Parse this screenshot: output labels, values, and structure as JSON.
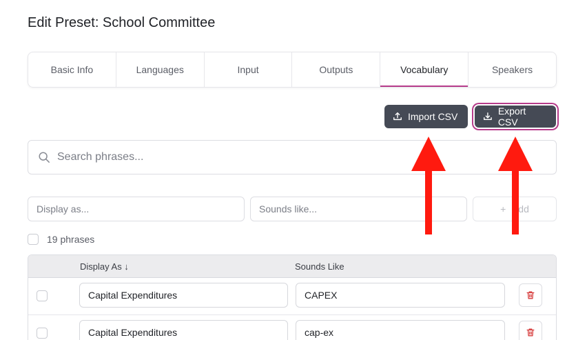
{
  "page": {
    "title": "Edit Preset: School Committee"
  },
  "tabs": [
    {
      "label": "Basic Info",
      "active": false
    },
    {
      "label": "Languages",
      "active": false
    },
    {
      "label": "Input",
      "active": false
    },
    {
      "label": "Outputs",
      "active": false
    },
    {
      "label": "Vocabulary",
      "active": true
    },
    {
      "label": "Speakers",
      "active": false
    }
  ],
  "toolbar": {
    "import_label": "Import CSV",
    "export_label": "Export CSV"
  },
  "search": {
    "placeholder": "Search phrases..."
  },
  "add_form": {
    "display_placeholder": "Display as...",
    "sounds_placeholder": "Sounds like...",
    "add_label": "Add",
    "add_label_visible": "dd"
  },
  "list": {
    "count_label": "19 phrases"
  },
  "table": {
    "columns": {
      "display": "Display As ↓",
      "sounds": "Sounds Like"
    },
    "rows": [
      {
        "display": "Capital Expenditures",
        "sounds": "CAPEX"
      },
      {
        "display": "Capital Expenditures",
        "sounds": "cap-ex"
      }
    ]
  },
  "colors": {
    "accent": "#b63b8a",
    "button_dark": "#454a55",
    "annotation_arrow": "#ff1a0f",
    "delete_icon": "#d63a3a"
  }
}
